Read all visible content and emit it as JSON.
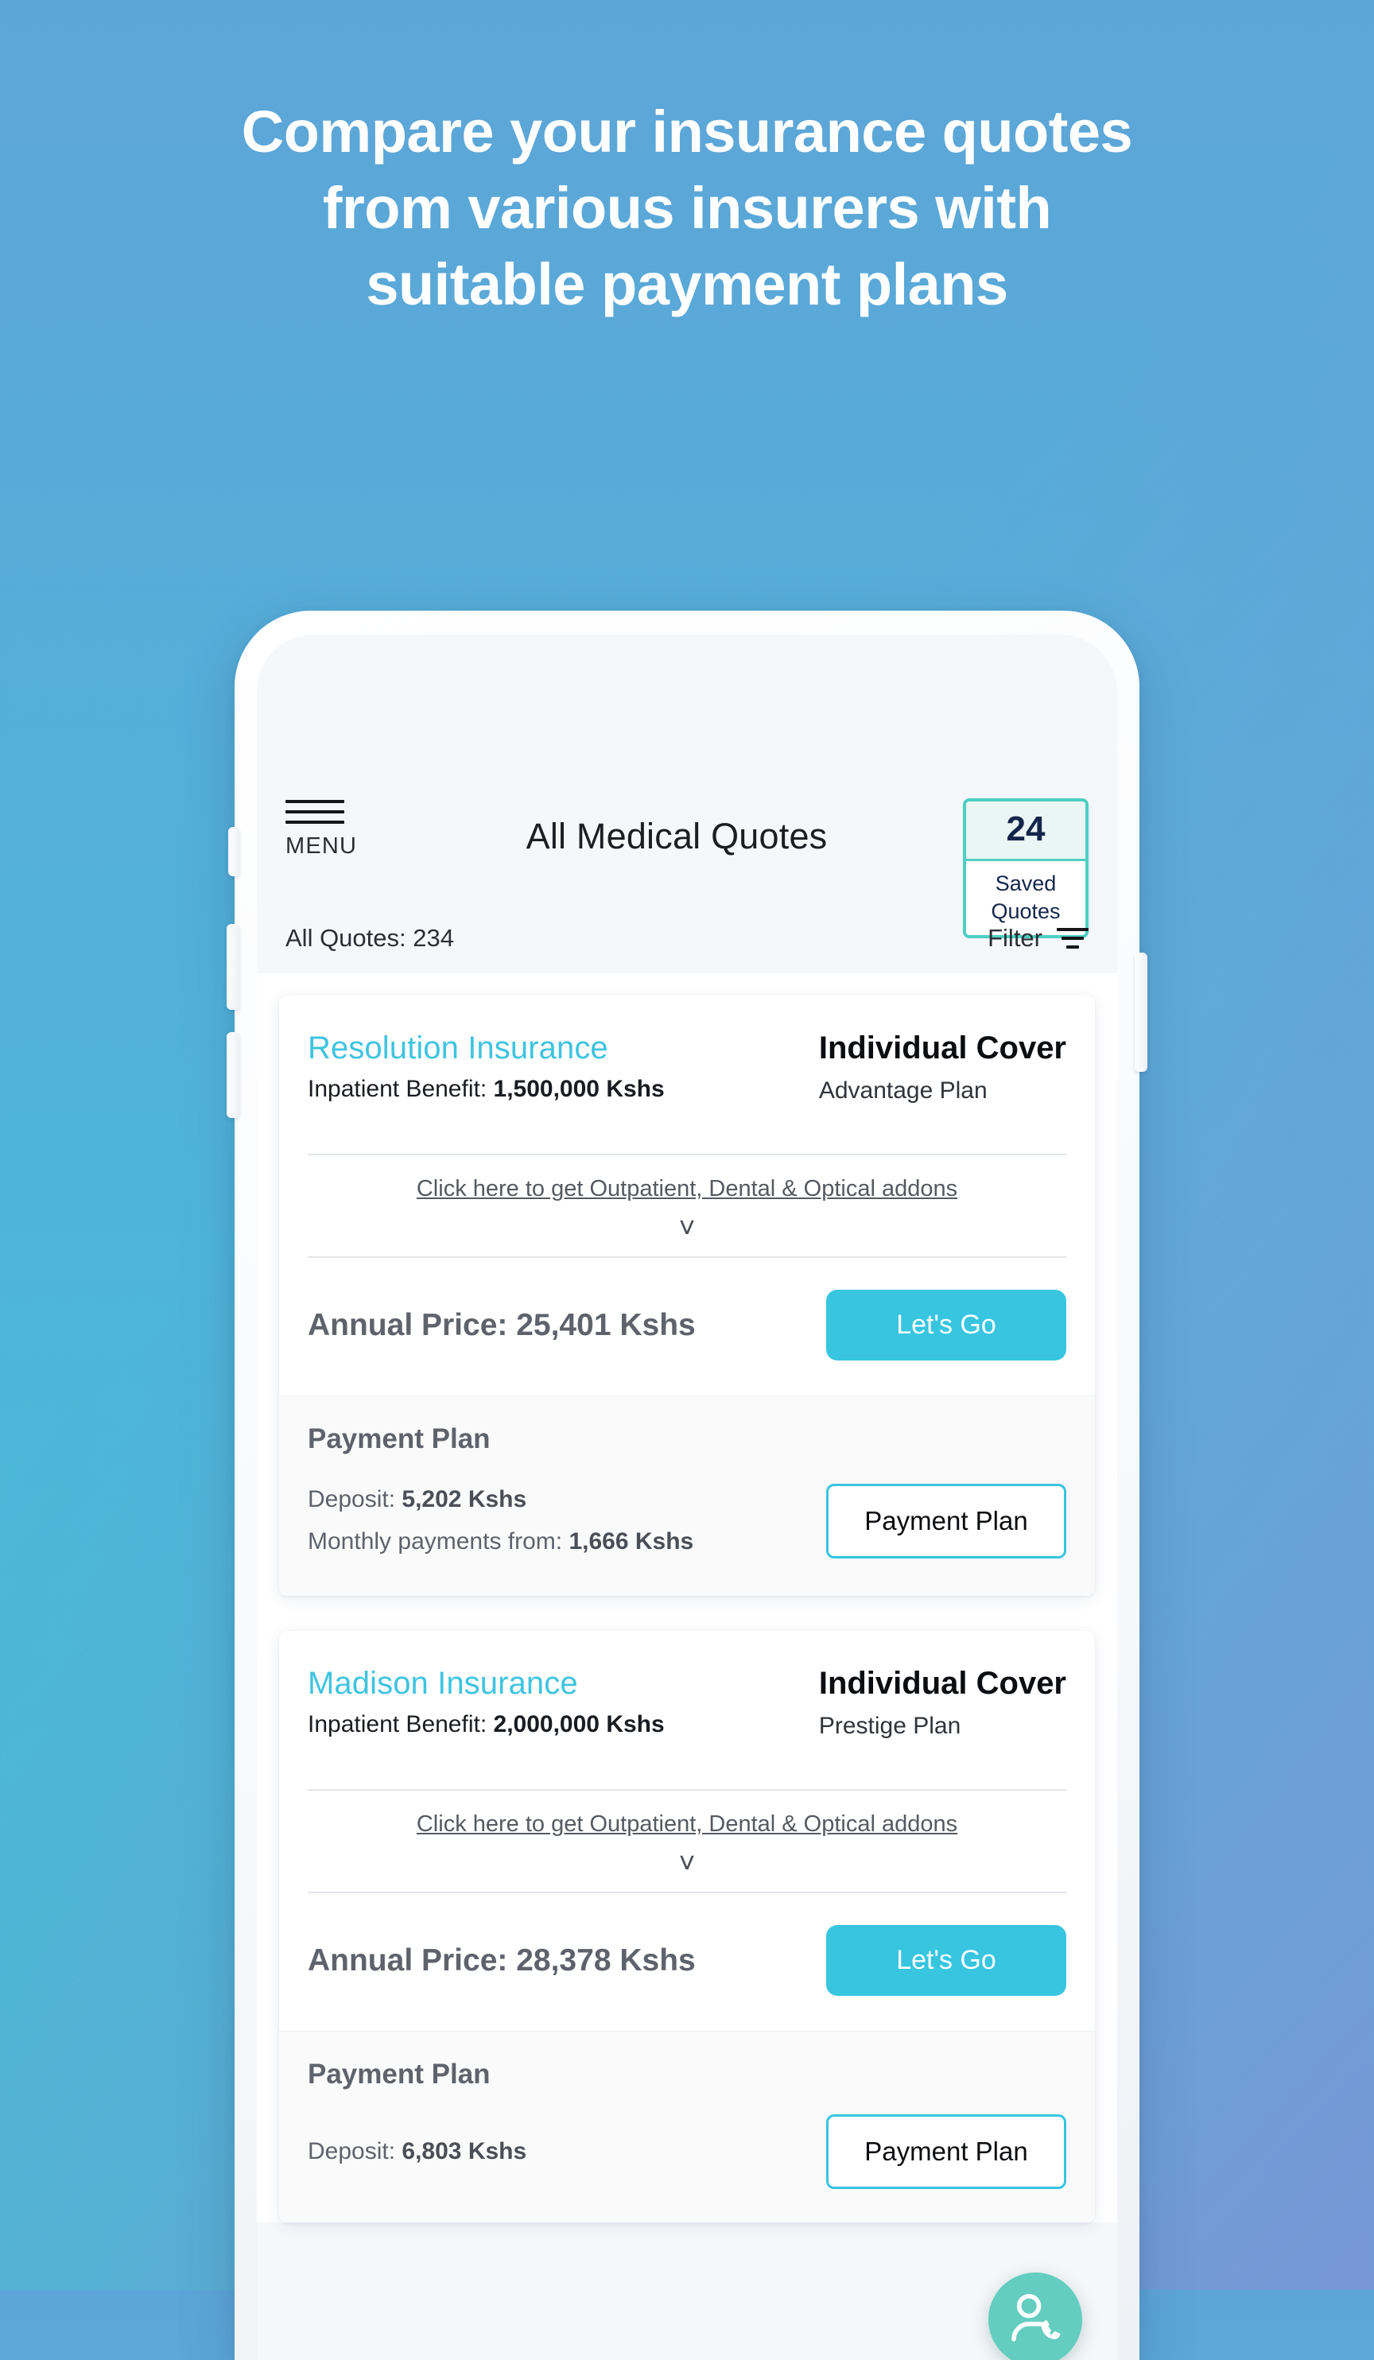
{
  "hero": {
    "lines": [
      "Compare your insurance quotes",
      "from various insurers with",
      "suitable payment plans"
    ]
  },
  "colors": {
    "bg_top_left": "#5DA5D8",
    "bg_top_right": "#7697D4",
    "bg_bottom_left": "#3EC1D3",
    "bg_bottom_right": "#47B6D6",
    "accent_cyan": "#37C5E0",
    "accent_teal": "#4ECFC2",
    "navy_text": "#14264B",
    "fab_teal": "#63CDC0"
  },
  "app": {
    "header": {
      "menu_label": "MENU",
      "menu_icon": "hamburger-icon",
      "title": "All Medical Quotes",
      "saved": {
        "count": "24",
        "label": "Saved Quotes"
      },
      "all_quotes": "All Quotes: 234",
      "filter_label": "Filter",
      "filter_icon": "filter-icon"
    },
    "quotes": [
      {
        "insurer": "Resolution Insurance",
        "benefit_label": "Inpatient Benefit:",
        "benefit_value": "1,500,000 Kshs",
        "cover_type": "Individual Cover",
        "plan_name": "Advantage Plan",
        "addon_link": "Click here to get Outpatient, Dental & Optical addons",
        "expand_icon": "chevron-down-icon",
        "annual_price": "Annual Price: 25,401 Kshs",
        "cta_label": "Let's Go",
        "payment_plan_title": "Payment Plan",
        "deposit_label": "Deposit:",
        "deposit_value": "5,202 Kshs",
        "monthly_label": "Monthly payments from:",
        "monthly_value": "1,666 Kshs",
        "payment_plan_button": "Payment Plan"
      },
      {
        "insurer": "Madison Insurance",
        "benefit_label": "Inpatient Benefit:",
        "benefit_value": "2,000,000 Kshs",
        "cover_type": "Individual Cover",
        "plan_name": "Prestige Plan",
        "addon_link": "Click here to get Outpatient, Dental & Optical addons",
        "expand_icon": "chevron-down-icon",
        "annual_price": "Annual Price: 28,378 Kshs",
        "cta_label": "Let's Go",
        "payment_plan_title": "Payment Plan",
        "deposit_label": "Deposit:",
        "deposit_value": "6,803 Kshs",
        "monthly_label": "",
        "monthly_value": "",
        "payment_plan_button": "Payment Plan"
      }
    ],
    "support_fab": {
      "icon": "support-agent-icon"
    }
  }
}
